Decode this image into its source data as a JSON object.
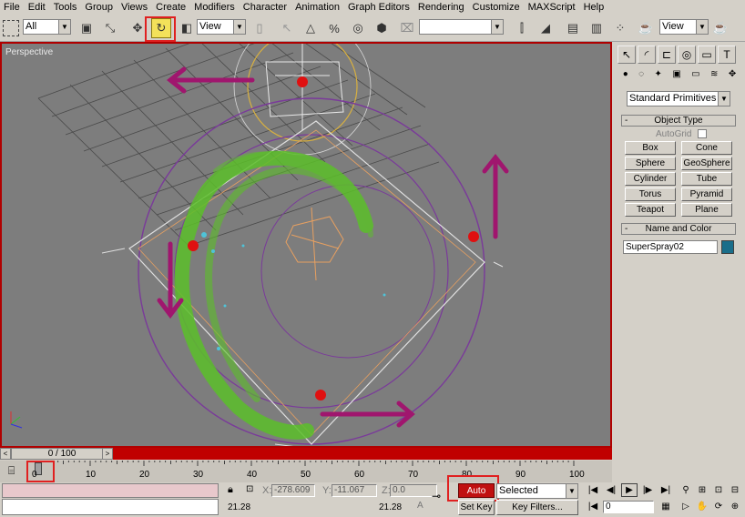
{
  "menu": [
    "File",
    "Edit",
    "Tools",
    "Group",
    "Views",
    "Create",
    "Modifiers",
    "Character",
    "Animation",
    "Graph Editors",
    "Rendering",
    "Customize",
    "MAXScript",
    "Help"
  ],
  "toolbar": {
    "filter_value": "All",
    "ref_coord_value": "View",
    "named_sel_value": "",
    "viewport_shading_value": "View"
  },
  "viewport": {
    "label": "Perspective"
  },
  "command_panel": {
    "category_value": "Standard Primitives",
    "object_type_title": "Object Type",
    "autogrid_label": "AutoGrid",
    "buttons": [
      "Box",
      "Cone",
      "Sphere",
      "GeoSphere",
      "Cylinder",
      "Tube",
      "Torus",
      "Pyramid",
      "Teapot",
      "Plane"
    ],
    "name_color_title": "Name and Color",
    "object_name": "SuperSpray02",
    "object_color": "#1a6e8a"
  },
  "time_slider": {
    "label": "0 / 100"
  },
  "trackbar": {
    "ticks": [
      "0",
      "10",
      "20",
      "30",
      "40",
      "50",
      "60",
      "70",
      "80",
      "90",
      "100"
    ]
  },
  "status": {
    "x_label": "X:",
    "x_value": "-278.609",
    "y_label": "Y:",
    "y_value": "-11.067",
    "z_label": "Z:",
    "z_value": "0.0",
    "grid_left": "21.28",
    "grid_mid": "21.28",
    "auto_key": "Auto Key",
    "set_key": "Set Key",
    "selected_value": "Selected",
    "key_filters": "Key Filters...",
    "frame_value": "0"
  },
  "colors": {
    "accent_red": "#e02020",
    "arrow_magenta": "#a0166e",
    "particle_green": "#5cbf2a",
    "orbit_purple": "#7a3a9a"
  }
}
